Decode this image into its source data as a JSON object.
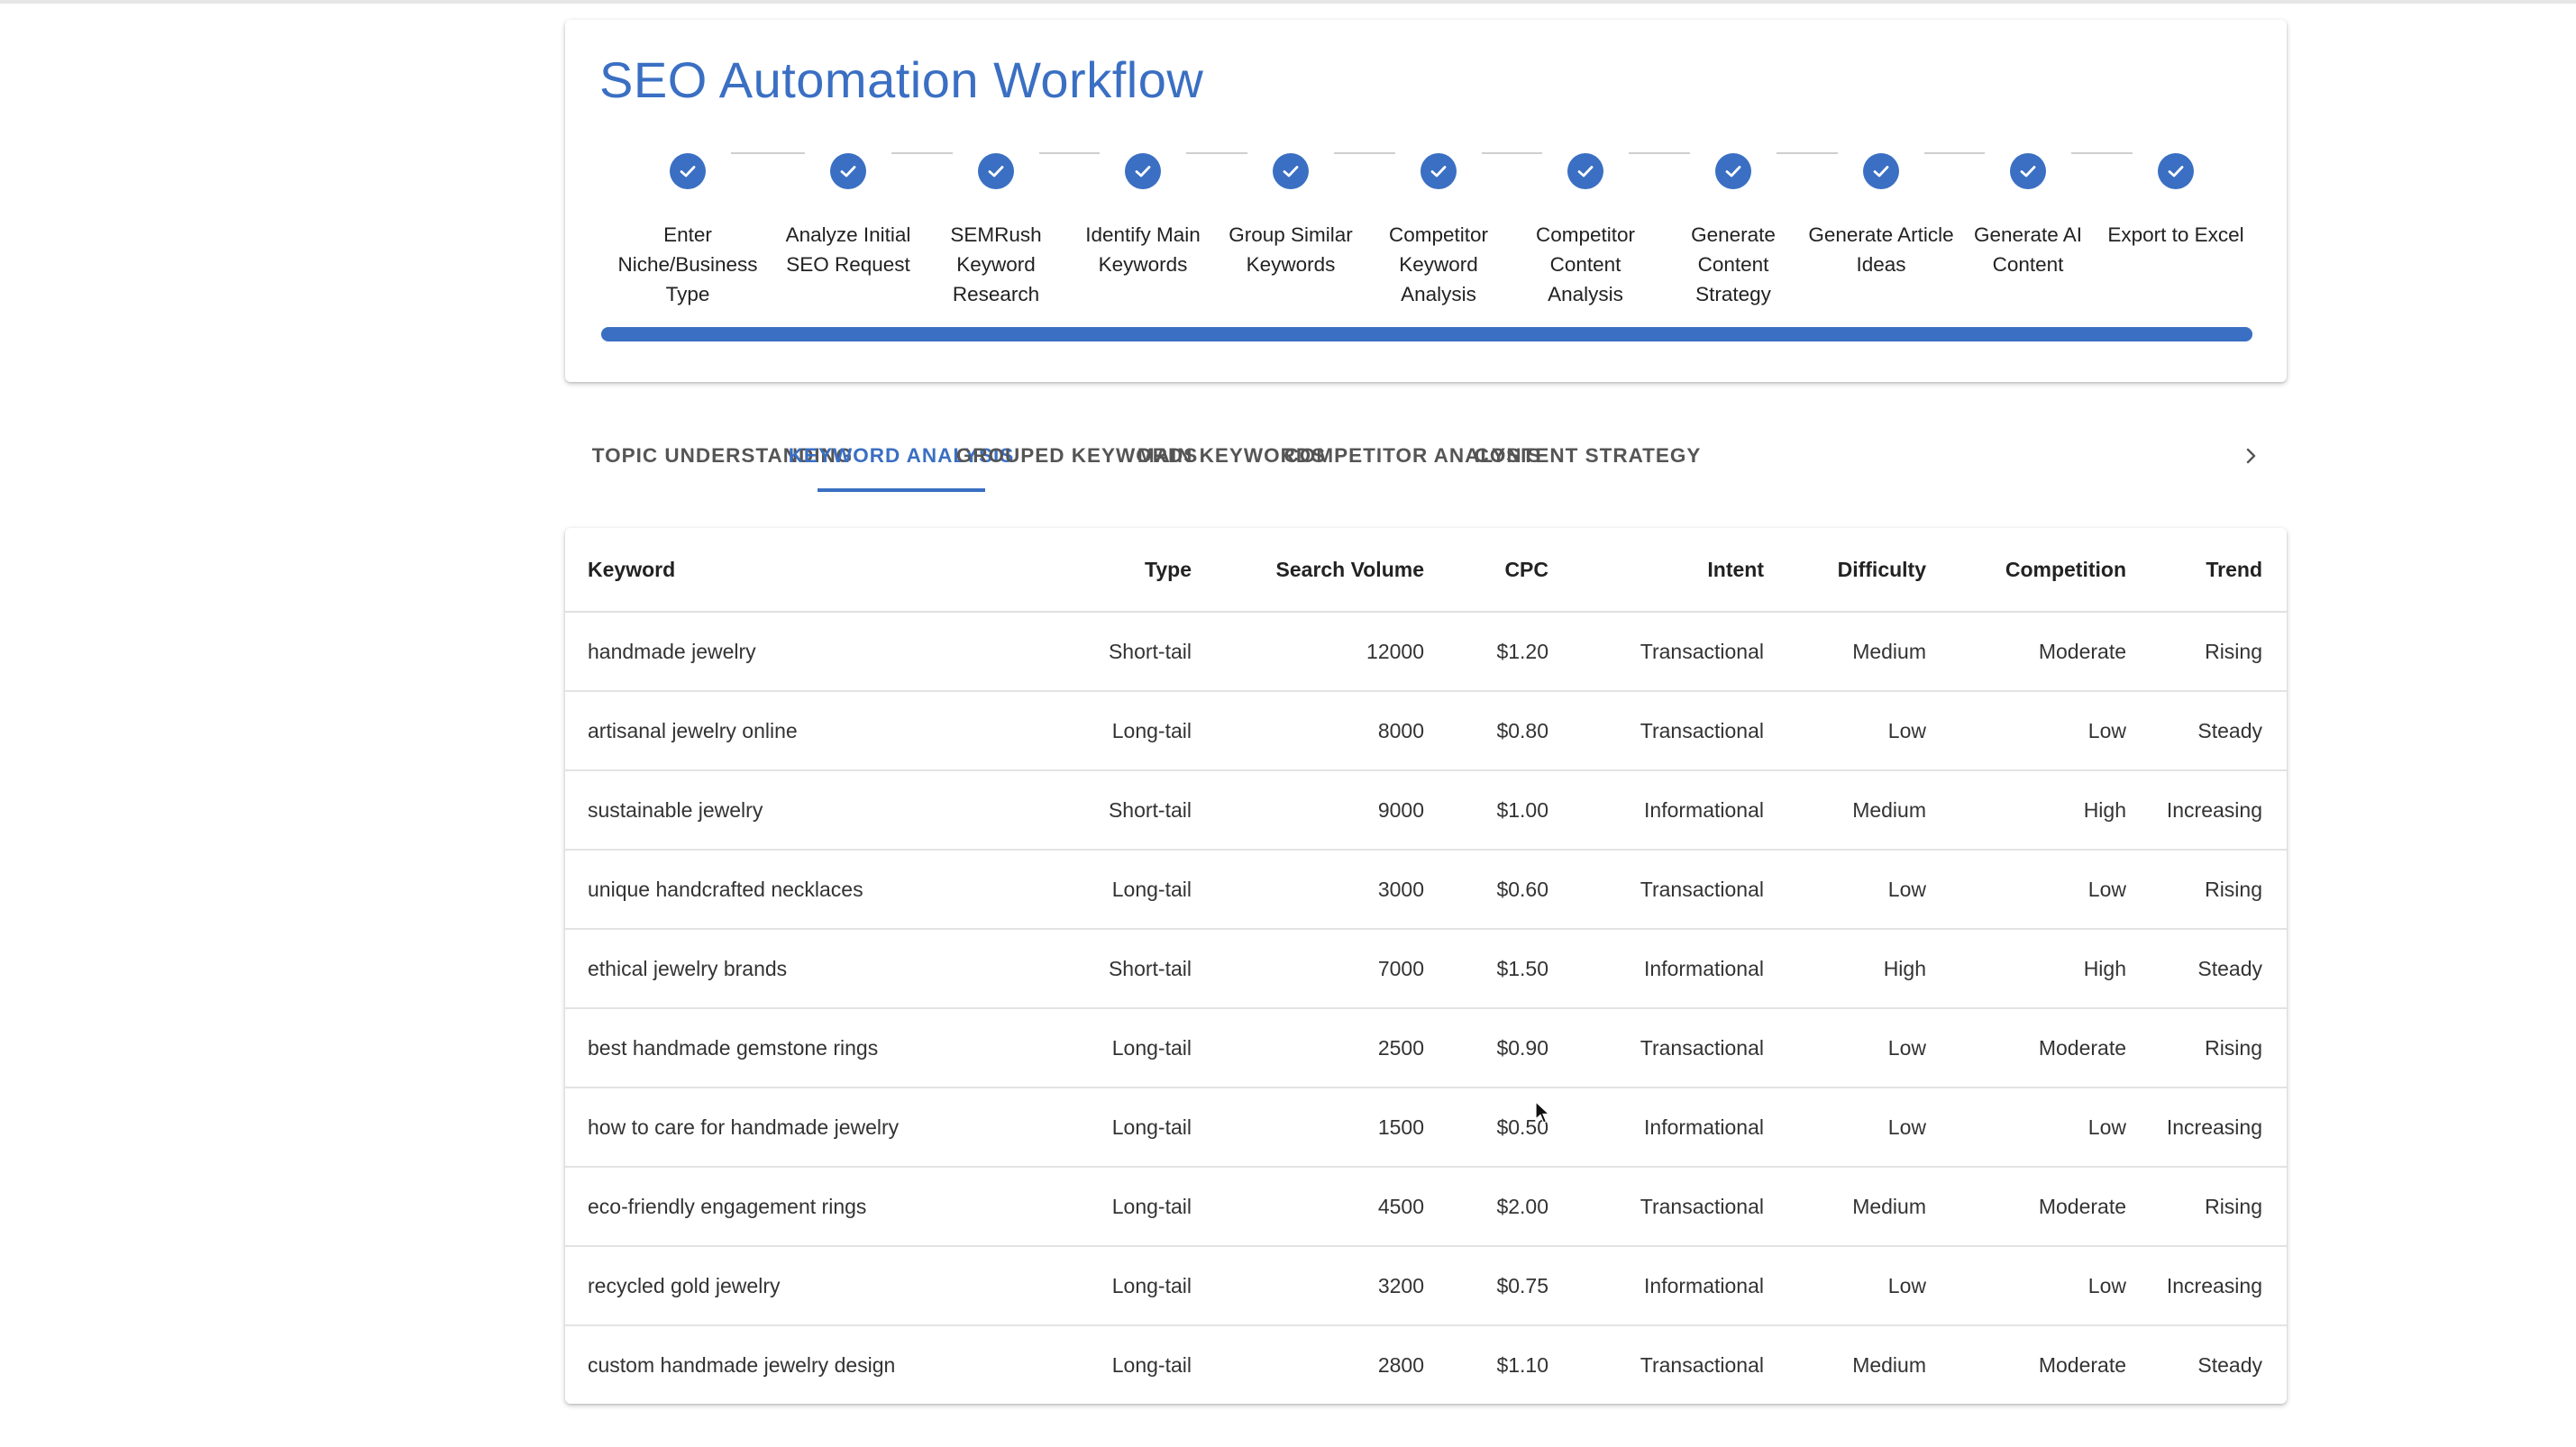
{
  "workflow": {
    "title": "SEO Automation Workflow",
    "progress_percent": 100,
    "accent_color": "#3a6fc3",
    "steps": [
      {
        "label": "Enter Niche/Business Type",
        "status": "completed",
        "icon": "check-icon"
      },
      {
        "label": "Analyze Initial SEO Request",
        "status": "completed",
        "icon": "check-icon"
      },
      {
        "label": "SEMRush Keyword Research",
        "status": "completed",
        "icon": "check-icon"
      },
      {
        "label": "Identify Main Keywords",
        "status": "completed",
        "icon": "check-icon"
      },
      {
        "label": "Group Similar Keywords",
        "status": "completed",
        "icon": "check-icon"
      },
      {
        "label": "Competitor Keyword Analysis",
        "status": "completed",
        "icon": "check-icon"
      },
      {
        "label": "Competitor Content Analysis",
        "status": "completed",
        "icon": "check-icon"
      },
      {
        "label": "Generate Content Strategy",
        "status": "completed",
        "icon": "check-icon"
      },
      {
        "label": "Generate Article Ideas",
        "status": "completed",
        "icon": "check-icon"
      },
      {
        "label": "Generate AI Content",
        "status": "completed",
        "icon": "check-icon"
      },
      {
        "label": "Export to Excel",
        "status": "completed",
        "icon": "check-icon"
      }
    ]
  },
  "tabs": {
    "items": [
      {
        "label": "TOPIC UNDERSTANDING",
        "active": false
      },
      {
        "label": "KEYWORD ANALYSIS",
        "active": true
      },
      {
        "label": "GROUPED KEYWORDS",
        "active": false
      },
      {
        "label": "MAIN KEYWORDS",
        "active": false
      },
      {
        "label": "COMPETITOR ANALYSIS",
        "active": false
      },
      {
        "label": "CONTENT STRATEGY",
        "active": false
      }
    ],
    "scroll_icon": "chevron-right-icon"
  },
  "table": {
    "columns": [
      "Keyword",
      "Type",
      "Search Volume",
      "CPC",
      "Intent",
      "Difficulty",
      "Competition",
      "Trend"
    ],
    "rows": [
      [
        "handmade jewelry",
        "Short-tail",
        "12000",
        "$1.20",
        "Transactional",
        "Medium",
        "Moderate",
        "Rising"
      ],
      [
        "artisanal jewelry online",
        "Long-tail",
        "8000",
        "$0.80",
        "Transactional",
        "Low",
        "Low",
        "Steady"
      ],
      [
        "sustainable jewelry",
        "Short-tail",
        "9000",
        "$1.00",
        "Informational",
        "Medium",
        "High",
        "Increasing"
      ],
      [
        "unique handcrafted necklaces",
        "Long-tail",
        "3000",
        "$0.60",
        "Transactional",
        "Low",
        "Low",
        "Rising"
      ],
      [
        "ethical jewelry brands",
        "Short-tail",
        "7000",
        "$1.50",
        "Informational",
        "High",
        "High",
        "Steady"
      ],
      [
        "best handmade gemstone rings",
        "Long-tail",
        "2500",
        "$0.90",
        "Transactional",
        "Low",
        "Moderate",
        "Rising"
      ],
      [
        "how to care for handmade jewelry",
        "Long-tail",
        "1500",
        "$0.50",
        "Informational",
        "Low",
        "Low",
        "Increasing"
      ],
      [
        "eco-friendly engagement rings",
        "Long-tail",
        "4500",
        "$2.00",
        "Transactional",
        "Medium",
        "Moderate",
        "Rising"
      ],
      [
        "recycled gold jewelry",
        "Long-tail",
        "3200",
        "$0.75",
        "Informational",
        "Low",
        "Low",
        "Increasing"
      ],
      [
        "custom handmade jewelry design",
        "Long-tail",
        "2800",
        "$1.10",
        "Transactional",
        "Medium",
        "Moderate",
        "Steady"
      ]
    ]
  }
}
